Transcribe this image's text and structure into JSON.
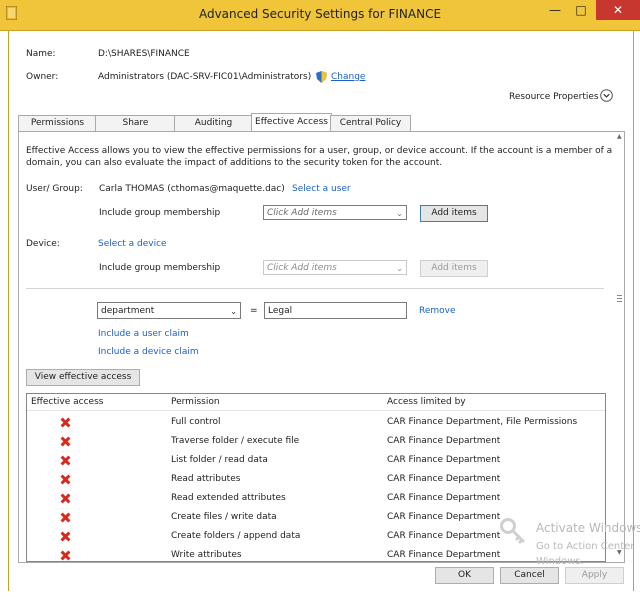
{
  "window": {
    "title": "Advanced Security Settings for FINANCE"
  },
  "info": {
    "name_label": "Name:",
    "name_value": "D:\\SHARES\\FINANCE",
    "owner_label": "Owner:",
    "owner_value": "Administrators (DAC-SRV-FIC01\\Administrators)",
    "change_link": "Change",
    "resource_properties": "Resource Properties"
  },
  "tabs": [
    {
      "label": "Permissions"
    },
    {
      "label": "Share"
    },
    {
      "label": "Auditing"
    },
    {
      "label": "Effective Access"
    },
    {
      "label": "Central Policy"
    }
  ],
  "effective": {
    "description_line1": "Effective Access allows you to view the effective permissions for a user, group, or device account. If the account is a member of a",
    "description_line2": "domain, you can also evaluate the impact of additions to the security token for the account.",
    "user_group_label": "User/ Group:",
    "user_value": "Carla THOMAS (cthomas@maquette.dac)",
    "select_user_link": "Select a user",
    "include_group_label": "Include group membership",
    "user_combo_placeholder": "Click Add items",
    "add_items_label": "Add items",
    "device_label": "Device:",
    "select_device_link": "Select a device",
    "device_include_group_label": "Include group membership",
    "device_combo_placeholder": "Click Add items",
    "device_add_items_label": "Add items",
    "claim_attribute": "department",
    "claim_operator": "=",
    "claim_value": "Legal",
    "remove_link": "Remove",
    "include_user_claim": "Include a user claim",
    "include_device_claim": "Include a device claim",
    "view_effective_access": "View effective access"
  },
  "table": {
    "columns": [
      "Effective access",
      "Permission",
      "Access limited by"
    ],
    "rows": [
      {
        "access": "denied",
        "permission": "Full control",
        "limited_by": "CAR Finance Department, File Permissions"
      },
      {
        "access": "denied",
        "permission": "Traverse folder / execute file",
        "limited_by": "CAR Finance Department"
      },
      {
        "access": "denied",
        "permission": "List folder / read data",
        "limited_by": "CAR Finance Department"
      },
      {
        "access": "denied",
        "permission": "Read attributes",
        "limited_by": "CAR Finance Department"
      },
      {
        "access": "denied",
        "permission": "Read extended attributes",
        "limited_by": "CAR Finance Department"
      },
      {
        "access": "denied",
        "permission": "Create files / write data",
        "limited_by": "CAR Finance Department"
      },
      {
        "access": "denied",
        "permission": "Create folders / append data",
        "limited_by": "CAR Finance Department"
      },
      {
        "access": "denied",
        "permission": "Write attributes",
        "limited_by": "CAR Finance Department"
      }
    ]
  },
  "footer": {
    "ok": "OK",
    "cancel": "Cancel",
    "apply": "Apply"
  },
  "watermark": {
    "line1": "Activate Windows",
    "line2": "Go to Action Center",
    "line3": "Windows."
  },
  "colors": {
    "titlebar": "#f0c53a",
    "close": "#c7372f",
    "link": "#1b5fc9",
    "deny": "#d52b1e"
  }
}
